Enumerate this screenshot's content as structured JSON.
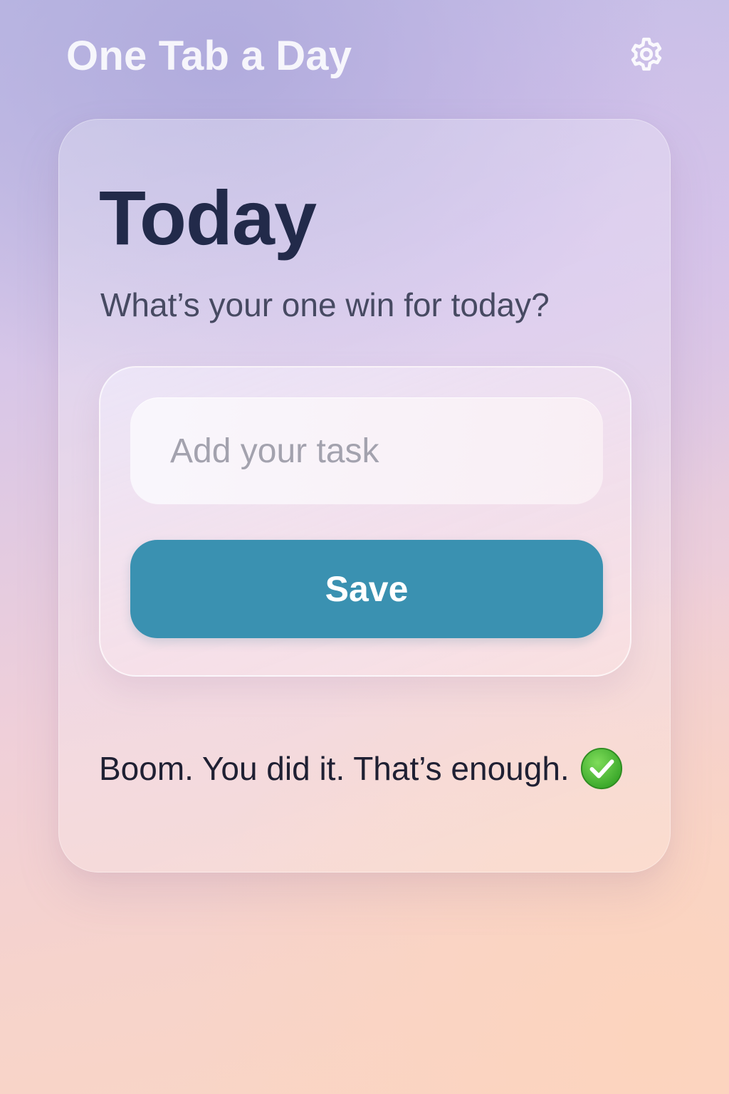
{
  "header": {
    "app_title": "One Tab a Day",
    "settings_icon": "gear-icon"
  },
  "card": {
    "heading": "Today",
    "subtitle": "What’s your one win for today?",
    "task_input": {
      "placeholder": "Add your task",
      "value": ""
    },
    "save_label": "Save",
    "confirmation": {
      "text": "Boom. You did it. That’s enough.",
      "icon": "check-mark-icon"
    }
  },
  "colors": {
    "accent": "#3a91b1",
    "heading": "#222a4a",
    "check_green": "#4cbf2f"
  }
}
